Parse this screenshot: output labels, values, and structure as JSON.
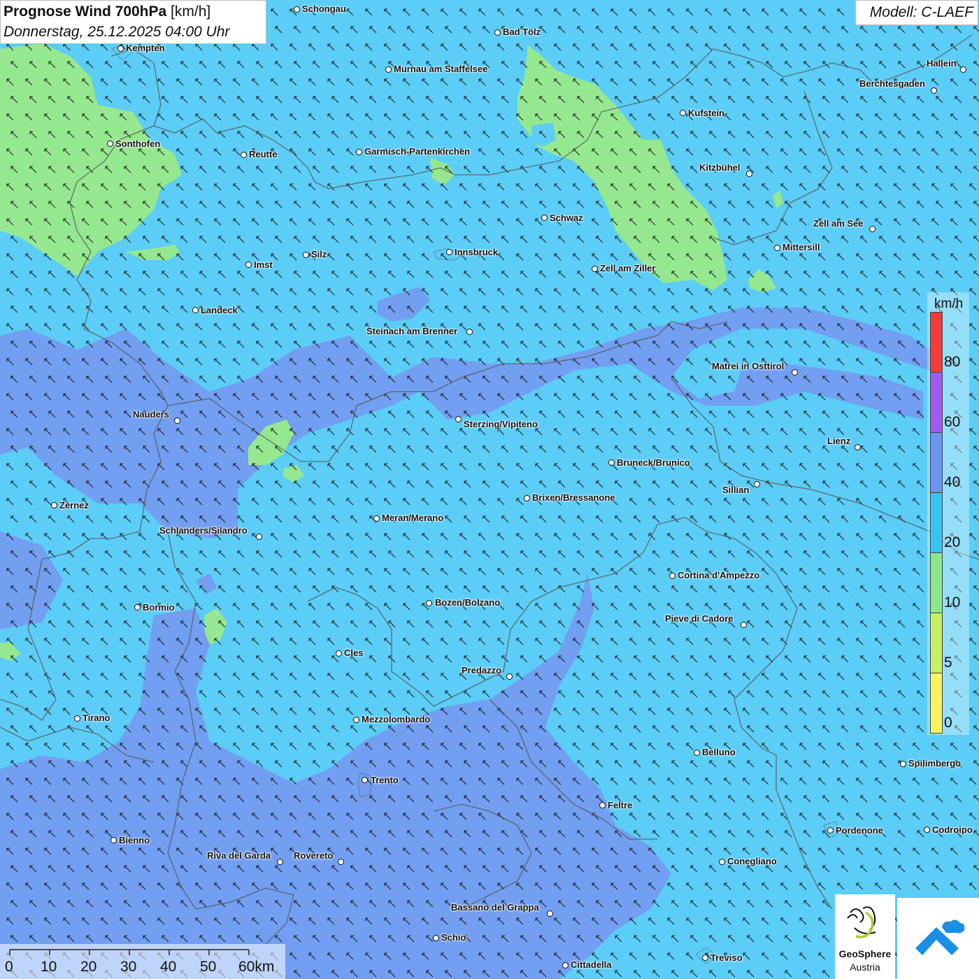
{
  "header": {
    "title_bold": "Prognose Wind 700hPa",
    "title_unit": "[km/h]",
    "date": "Donnerstag, 25.12.2025 04:00 Uhr"
  },
  "model": "Modell: C-LAEF",
  "legend": {
    "unit": "km/h",
    "levels": [
      {
        "label": "80",
        "color": "#f43a3a"
      },
      {
        "label": "60",
        "color": "#a25bf0"
      },
      {
        "label": "40",
        "color": "#6a97f4"
      },
      {
        "label": "20",
        "color": "#37c4f0"
      },
      {
        "label": "10",
        "color": "#8be888"
      },
      {
        "label": "5",
        "color": "#c7f060"
      },
      {
        "label": "0",
        "color": "#fbf260"
      }
    ]
  },
  "scale_bar": {
    "labels": [
      "0",
      "10",
      "20",
      "30",
      "40",
      "50",
      "60km"
    ]
  },
  "logos": {
    "geosphere_name": "GeoSphere",
    "geosphere_sub": "Austria"
  },
  "cities": [
    {
      "name": "Schongau"
    },
    {
      "name": "Bad Tölz"
    },
    {
      "name": "Kempten"
    },
    {
      "name": "Murnau am Staffelsee"
    },
    {
      "name": "Hallein"
    },
    {
      "name": "Berchtesgaden"
    },
    {
      "name": "Kufstein"
    },
    {
      "name": "Sonthofen"
    },
    {
      "name": "Reutte"
    },
    {
      "name": "Garmisch-Partenkirchen"
    },
    {
      "name": "Kitzbühel"
    },
    {
      "name": "Schwaz"
    },
    {
      "name": "Zell am See"
    },
    {
      "name": "Mittersill"
    },
    {
      "name": "Silz"
    },
    {
      "name": "Innsbruck"
    },
    {
      "name": "Imst"
    },
    {
      "name": "Zell am Ziller"
    },
    {
      "name": "Landeck"
    },
    {
      "name": "Steinach am Brenner"
    },
    {
      "name": "Matrei in Osttirol"
    },
    {
      "name": "Nauders"
    },
    {
      "name": "Sterzing/Vipiteno"
    },
    {
      "name": "Lienz"
    },
    {
      "name": "Bruneck/Brunico"
    },
    {
      "name": "Sillian"
    },
    {
      "name": "Zernez"
    },
    {
      "name": "Brixen/Bressanone"
    },
    {
      "name": "Meran/Merano"
    },
    {
      "name": "Schlanders/Silandro"
    },
    {
      "name": "Cortina d'Ampezzo"
    },
    {
      "name": "Bozen/Bolzano"
    },
    {
      "name": "Bormio"
    },
    {
      "name": "Pieve di Cadore"
    },
    {
      "name": "Cles"
    },
    {
      "name": "Predazzo"
    },
    {
      "name": "Tirano"
    },
    {
      "name": "Mezzolombardo"
    },
    {
      "name": "Belluno"
    },
    {
      "name": "Spilimbergo"
    },
    {
      "name": "Trento"
    },
    {
      "name": "Feltre"
    },
    {
      "name": "Pordenone"
    },
    {
      "name": "Codroipo"
    },
    {
      "name": "Bienno"
    },
    {
      "name": "Riva del Garda"
    },
    {
      "name": "Rovereto"
    },
    {
      "name": "Conegliano"
    },
    {
      "name": "Bassano del Grappa"
    },
    {
      "name": "Schio"
    },
    {
      "name": "Treviso"
    },
    {
      "name": "Cittadella"
    }
  ]
}
